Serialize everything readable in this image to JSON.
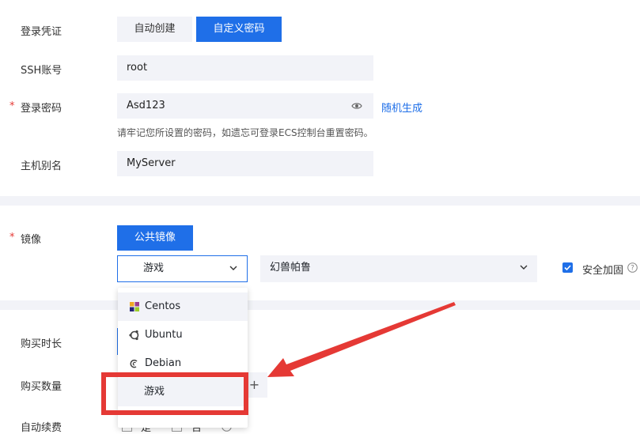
{
  "credentials": {
    "label": "登录凭证",
    "options": [
      "自动创建",
      "自定义密码"
    ]
  },
  "ssh": {
    "label": "SSH账号",
    "value": "root"
  },
  "password": {
    "label": "登录密码",
    "required_mark": "*",
    "value": "Asd123",
    "random_link": "随机生成",
    "hint": "请牢记您所设置的密码，如遗忘可登录ECS控制台重置密码。"
  },
  "alias": {
    "label": "主机别名",
    "value": "MyServer"
  },
  "image": {
    "label": "镜像",
    "required_mark": "*",
    "tab": "公共镜像",
    "category_select": "游戏",
    "game_select": "幻兽帕鲁",
    "security_label": "安全加固"
  },
  "dropdown": {
    "options": [
      "Centos",
      "Ubuntu",
      "Debian",
      "游戏"
    ]
  },
  "purchase": {
    "duration_label": "购买时长",
    "quantity_label": "购买数量",
    "quantity_plus": "+",
    "renew_label": "自动续费",
    "renew_yes": "是",
    "renew_no": "否"
  },
  "colors": {
    "accent": "#1f6fe8",
    "annotation": "#e53935",
    "field_bg": "#f2f3f8"
  }
}
